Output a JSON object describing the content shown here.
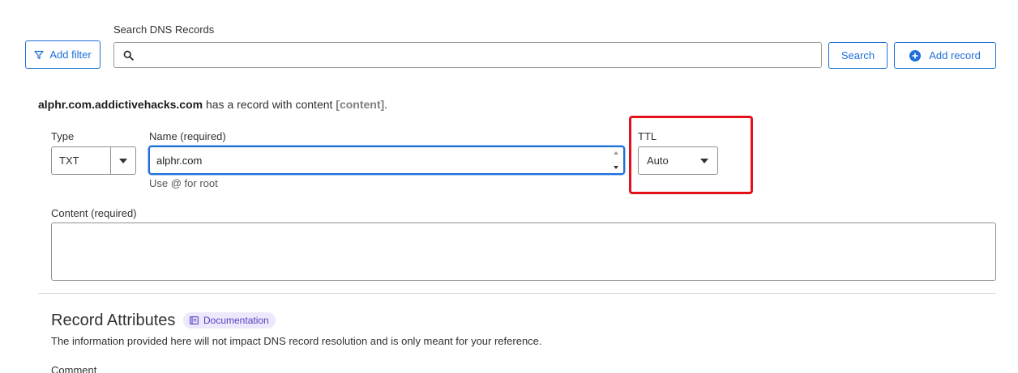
{
  "toolbar": {
    "add_filter_label": "Add filter",
    "search_label": "Search DNS Records",
    "search_value": "",
    "search_button_label": "Search",
    "add_record_label": "Add record"
  },
  "record": {
    "hostname": "alphr.com.addictivehacks.com",
    "sentence_middle": " has a record with content ",
    "content_placeholder": "[content]",
    "sentence_end": "."
  },
  "form": {
    "type_label": "Type",
    "type_value": "TXT",
    "name_label": "Name (required)",
    "name_value": "alphr.com",
    "name_hint": "Use @ for root",
    "ttl_label": "TTL",
    "ttl_value": "Auto",
    "content_label": "Content (required)",
    "content_value": ""
  },
  "attributes": {
    "title": "Record Attributes",
    "doc_label": "Documentation",
    "info": "The information provided here will not impact DNS record resolution and is only meant for your reference.",
    "comment_label": "Comment"
  },
  "colors": {
    "accent": "#1e6fd9",
    "highlight": "#e3111b",
    "badge_bg": "#ede8fb",
    "badge_text": "#5a3fc0"
  }
}
